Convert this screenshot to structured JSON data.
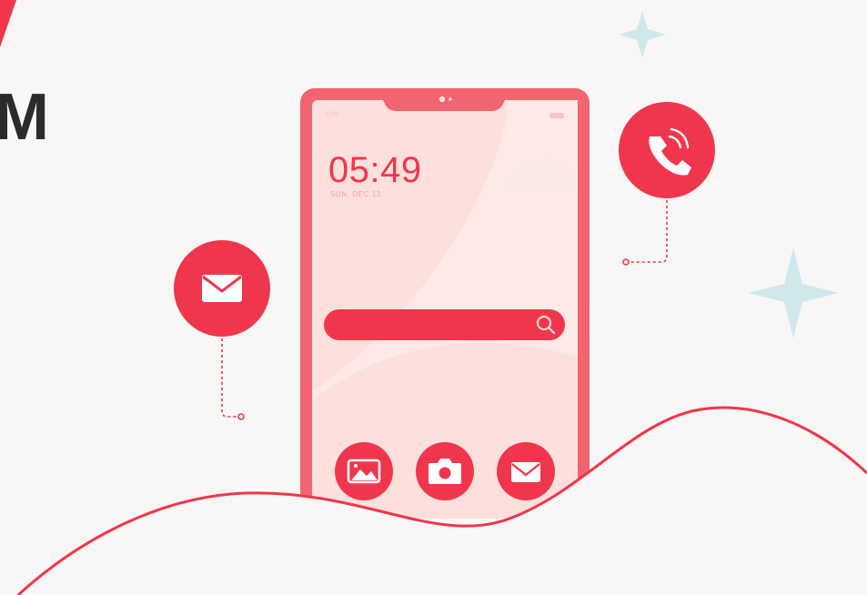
{
  "heading": {
    "fragment": "M"
  },
  "phone": {
    "status_left": "11%",
    "clock": "05:49",
    "date": "SUN, DEC 13"
  },
  "icons": {
    "mail_bubble": "envelope-icon",
    "call_bubble": "phone-call-icon",
    "search": "search-icon",
    "dock": [
      "image-icon",
      "camera-icon",
      "envelope-icon"
    ]
  },
  "colors": {
    "background": "#f9f7f6",
    "accent": "#f0364c",
    "phone_frame": "#f2646f",
    "screen": "#fde0dc",
    "sparkle": "#cfe8ec",
    "heading": "#2b2b2b"
  }
}
